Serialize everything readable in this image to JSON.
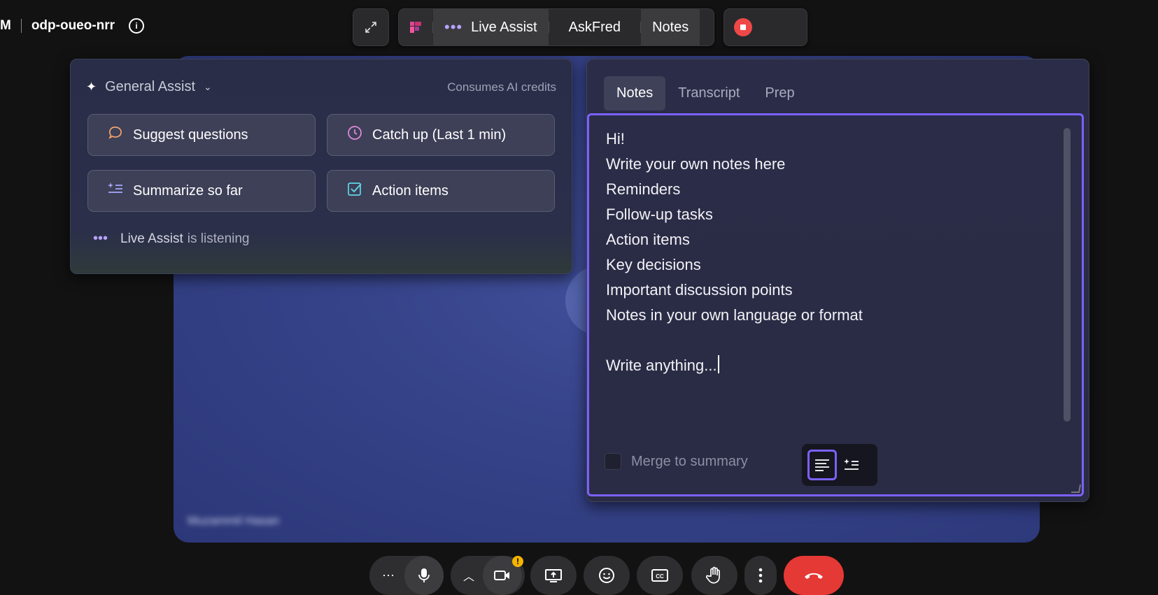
{
  "meeting": {
    "prefix": "M",
    "code": "odp-oueo-nrr"
  },
  "toolbar": {
    "live_assist": "Live Assist",
    "askfred": "AskFred",
    "notes": "Notes"
  },
  "assist": {
    "mode": "General Assist",
    "credits": "Consumes AI credits",
    "actions": [
      {
        "label": "Suggest questions",
        "icon": "chat-bubble-icon",
        "color": "#f7a36b"
      },
      {
        "label": "Catch up (Last 1 min)",
        "icon": "clock-icon",
        "color": "#e58be0"
      },
      {
        "label": "Summarize so far",
        "icon": "sparkle-list-icon",
        "color": "#a9a6ff"
      },
      {
        "label": "Action items",
        "icon": "checkbox-icon",
        "color": "#5fd6e6"
      }
    ],
    "listening_name": "Live Assist",
    "listening_text": "is listening"
  },
  "notes_panel": {
    "tabs": [
      "Notes",
      "Transcript",
      "Prep"
    ],
    "active_tab": "Notes",
    "lines": [
      "Hi!",
      "Write your own notes here",
      "Reminders",
      "Follow-up tasks",
      "Action items",
      "Key decisions",
      "Important discussion points",
      "Notes in your own language or format",
      "",
      "Write anything..."
    ],
    "merge_label": "Merge to summary",
    "merge_checked": false
  },
  "participant": {
    "name": "Muzammil Hasan"
  },
  "colors": {
    "accent": "#7b61ff",
    "end_call": "#e53935",
    "record": "#f04848",
    "warning": "#f4b400"
  }
}
